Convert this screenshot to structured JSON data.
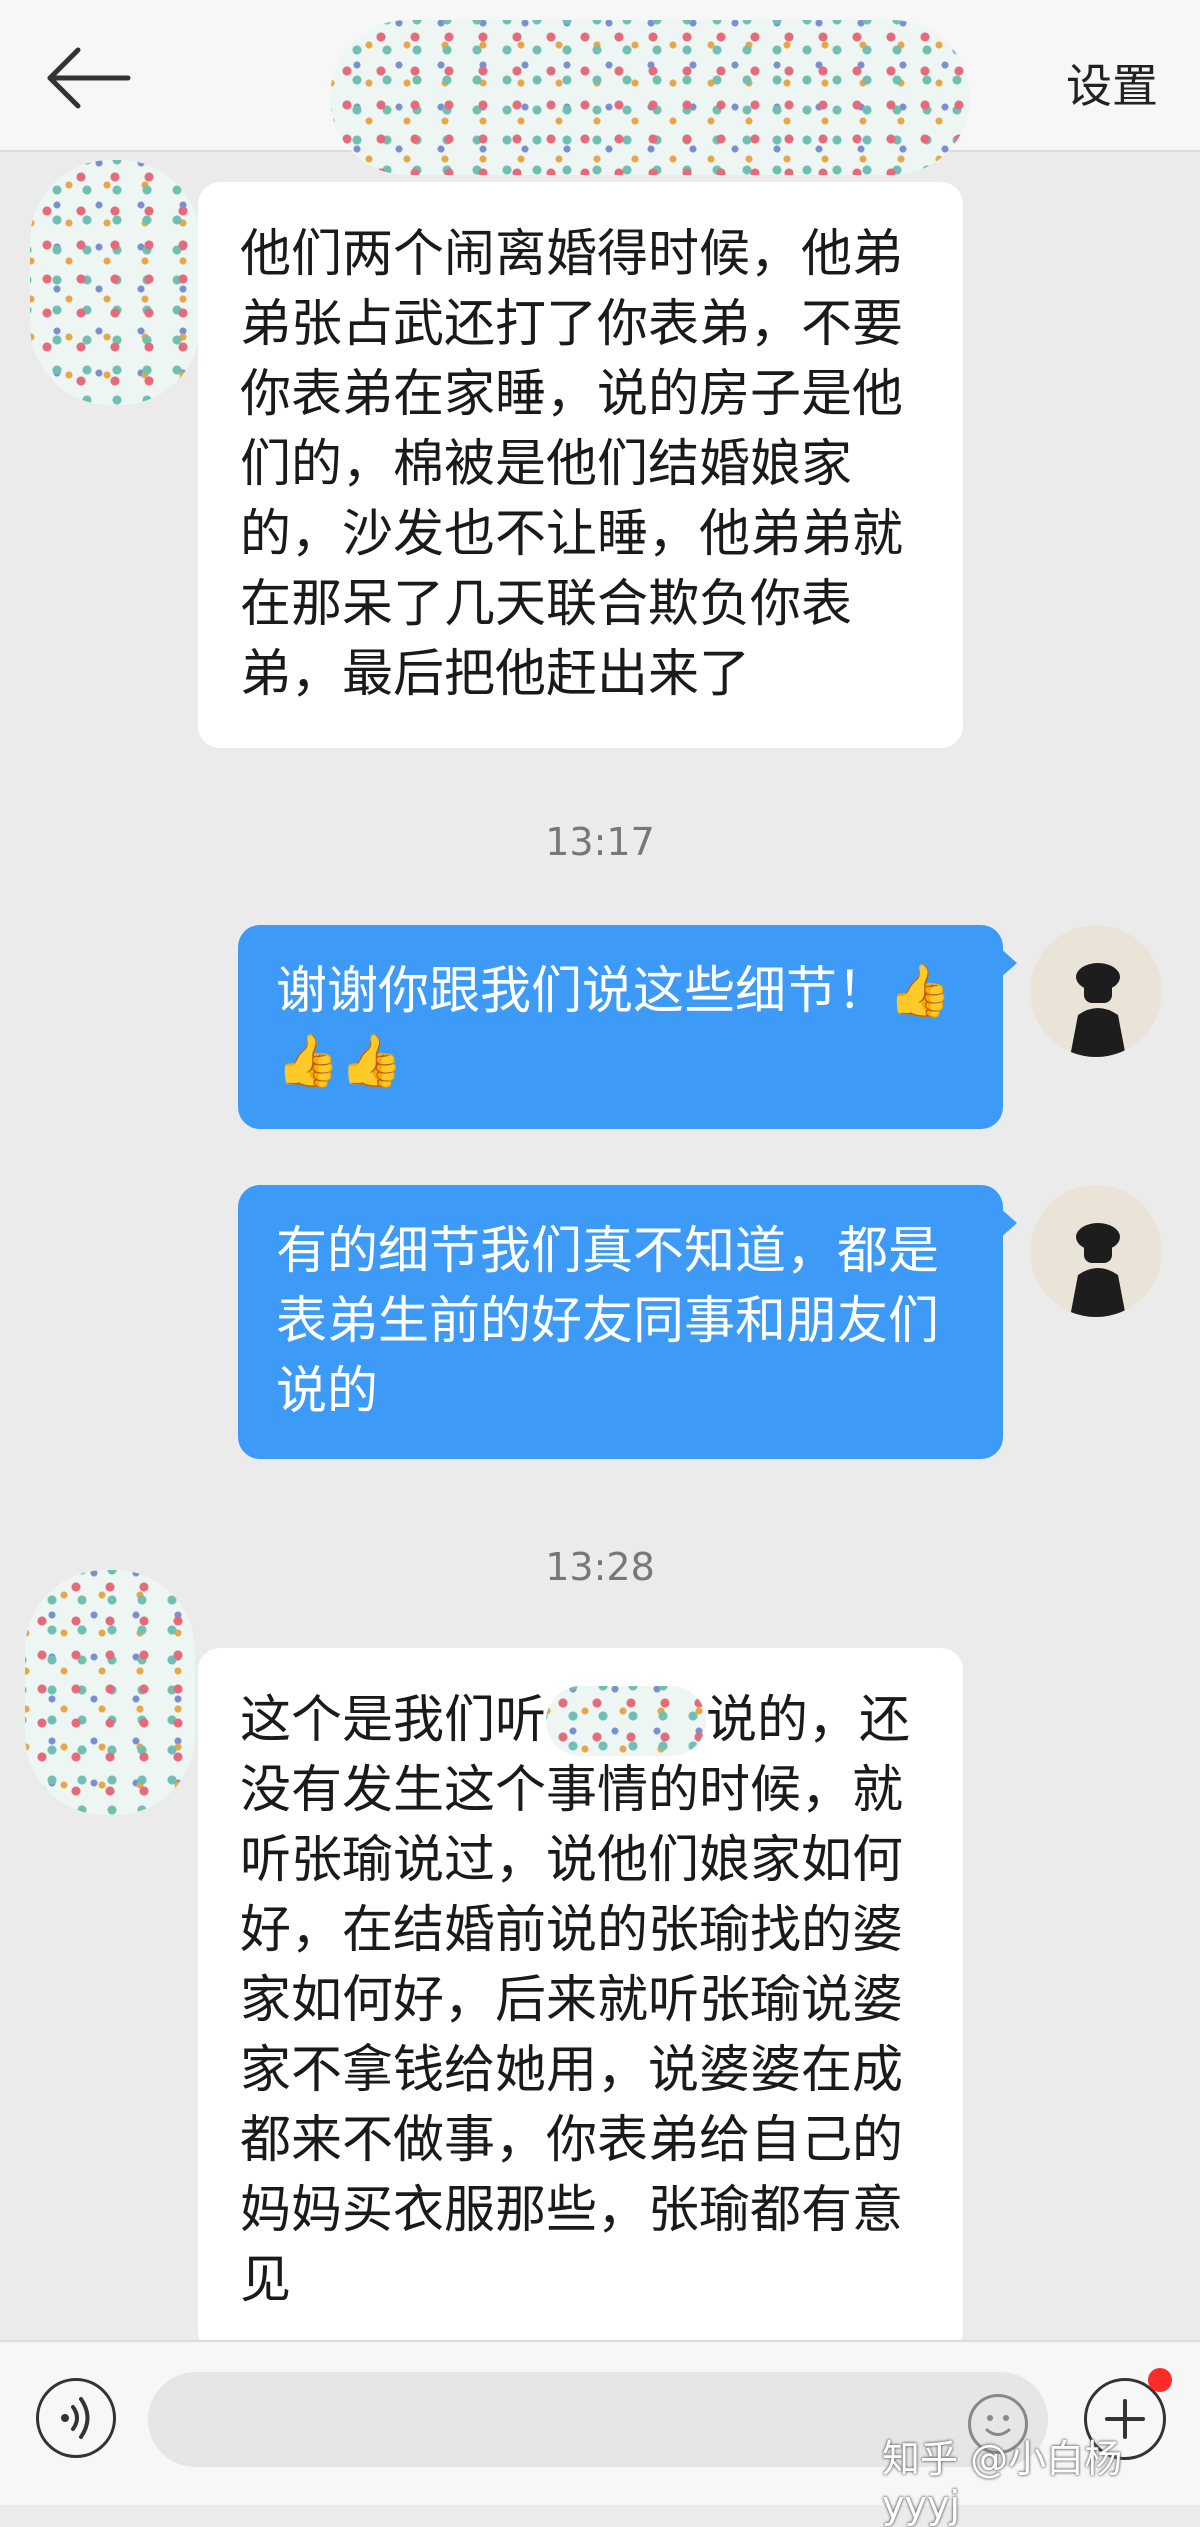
{
  "header": {
    "settings_label": "设置"
  },
  "messages": [
    {
      "type": "incoming",
      "text": "他们两个闹离婚得时候，他弟\n弟张占武还打了你表弟，不要\n你表弟在家睡，说的房子是他\n们的，棉被是他们结婚娘家\n的，沙发也不让睡，他弟弟就\n在那呆了几天联合欺负你表\n弟，最后把他赶出来了"
    },
    {
      "type": "time",
      "text": "13:17"
    },
    {
      "type": "outgoing",
      "text": "谢谢你跟我们说这些细节！👍\n👍👍"
    },
    {
      "type": "outgoing",
      "text": "有的细节我们真不知道，都是\n表弟生前的好友同事和朋友们\n说的"
    },
    {
      "type": "time",
      "text": "13:28"
    },
    {
      "type": "incoming",
      "text_before_mask": "这个是我们听",
      "text_after_mask": "说的，还\n没有发生这个事情的时候，就\n听张瑜说过，说他们娘家如何\n好，在结婚前说的张瑜找的婆\n家如何好，后来就听张瑜说婆\n家不拿钱给她用，说婆婆在成\n都来不做事，你表弟给自己的\n妈妈买衣服那些，张瑜都有意\n见"
    }
  ],
  "footer": {
    "watermark": "知乎 @小白杨yyyj",
    "input_placeholder": ""
  },
  "colors": {
    "outgoing_bubble": "#3d9bf7",
    "background": "#ebebeb",
    "notification_dot": "#ff2a2a"
  },
  "icons": [
    "back-arrow-icon",
    "voice-icon",
    "emoji-icon",
    "plus-icon"
  ]
}
